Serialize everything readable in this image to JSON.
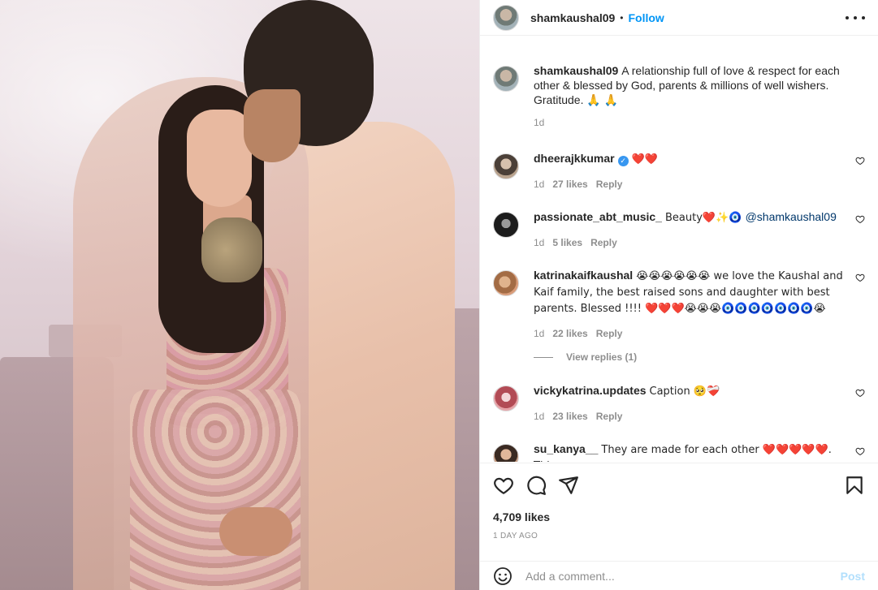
{
  "post": {
    "username": "shamkaushal09",
    "dot": "•",
    "follow_label": "Follow",
    "more_icon": "more-horizontal-icon"
  },
  "caption": {
    "username": "shamkaushal09",
    "text": "A relationship full of love & respect for each other & blessed by God, parents & millions of well wishers. Gratitude. 🙏 🙏",
    "time": "1d"
  },
  "comments": [
    {
      "username": "dheerajkkumar",
      "verified": true,
      "text": "❤️❤️",
      "time": "1d",
      "likes": "27 likes",
      "reply": "Reply"
    },
    {
      "username": "passionate_abt_music_",
      "text": "Beauty❤️✨🧿 ",
      "mention": "@shamkaushal09",
      "time": "1d",
      "likes": "5 likes",
      "reply": "Reply"
    },
    {
      "username": "katrinakaifkaushal",
      "text": "😭😭😭😭😭😭 we love the Kaushal and Kaif family, the best raised sons and daughter with best parents. Blessed !!!! ❤️❤️❤️😭😭😭🧿🧿🧿🧿🧿🧿🧿😭",
      "time": "1d",
      "likes": "22 likes",
      "reply": "Reply",
      "view_replies": "View replies (1)"
    },
    {
      "username": "vickykatrina.updates",
      "text": "Caption 🥺❤️‍🩹",
      "time": "1d",
      "likes": "23 likes",
      "reply": "Reply"
    },
    {
      "username": "su_kanya__",
      "text": "They are made for each other ❤️❤️❤️❤️❤️. This"
    }
  ],
  "actions": {
    "like_icon": "heart-outline-icon",
    "comment_icon": "comment-icon",
    "share_icon": "paper-plane-icon",
    "save_icon": "bookmark-icon",
    "likes": "4,709 likes",
    "ago": "1 DAY AGO"
  },
  "add_comment": {
    "emoji_icon": "smiley-icon",
    "placeholder": "Add a comment...",
    "post_label": "Post"
  },
  "colors": {
    "link_blue": "#0095f6",
    "post_disabled": "#b2dffc",
    "secondary_text": "#8e8e8e",
    "primary_text": "#262626"
  }
}
